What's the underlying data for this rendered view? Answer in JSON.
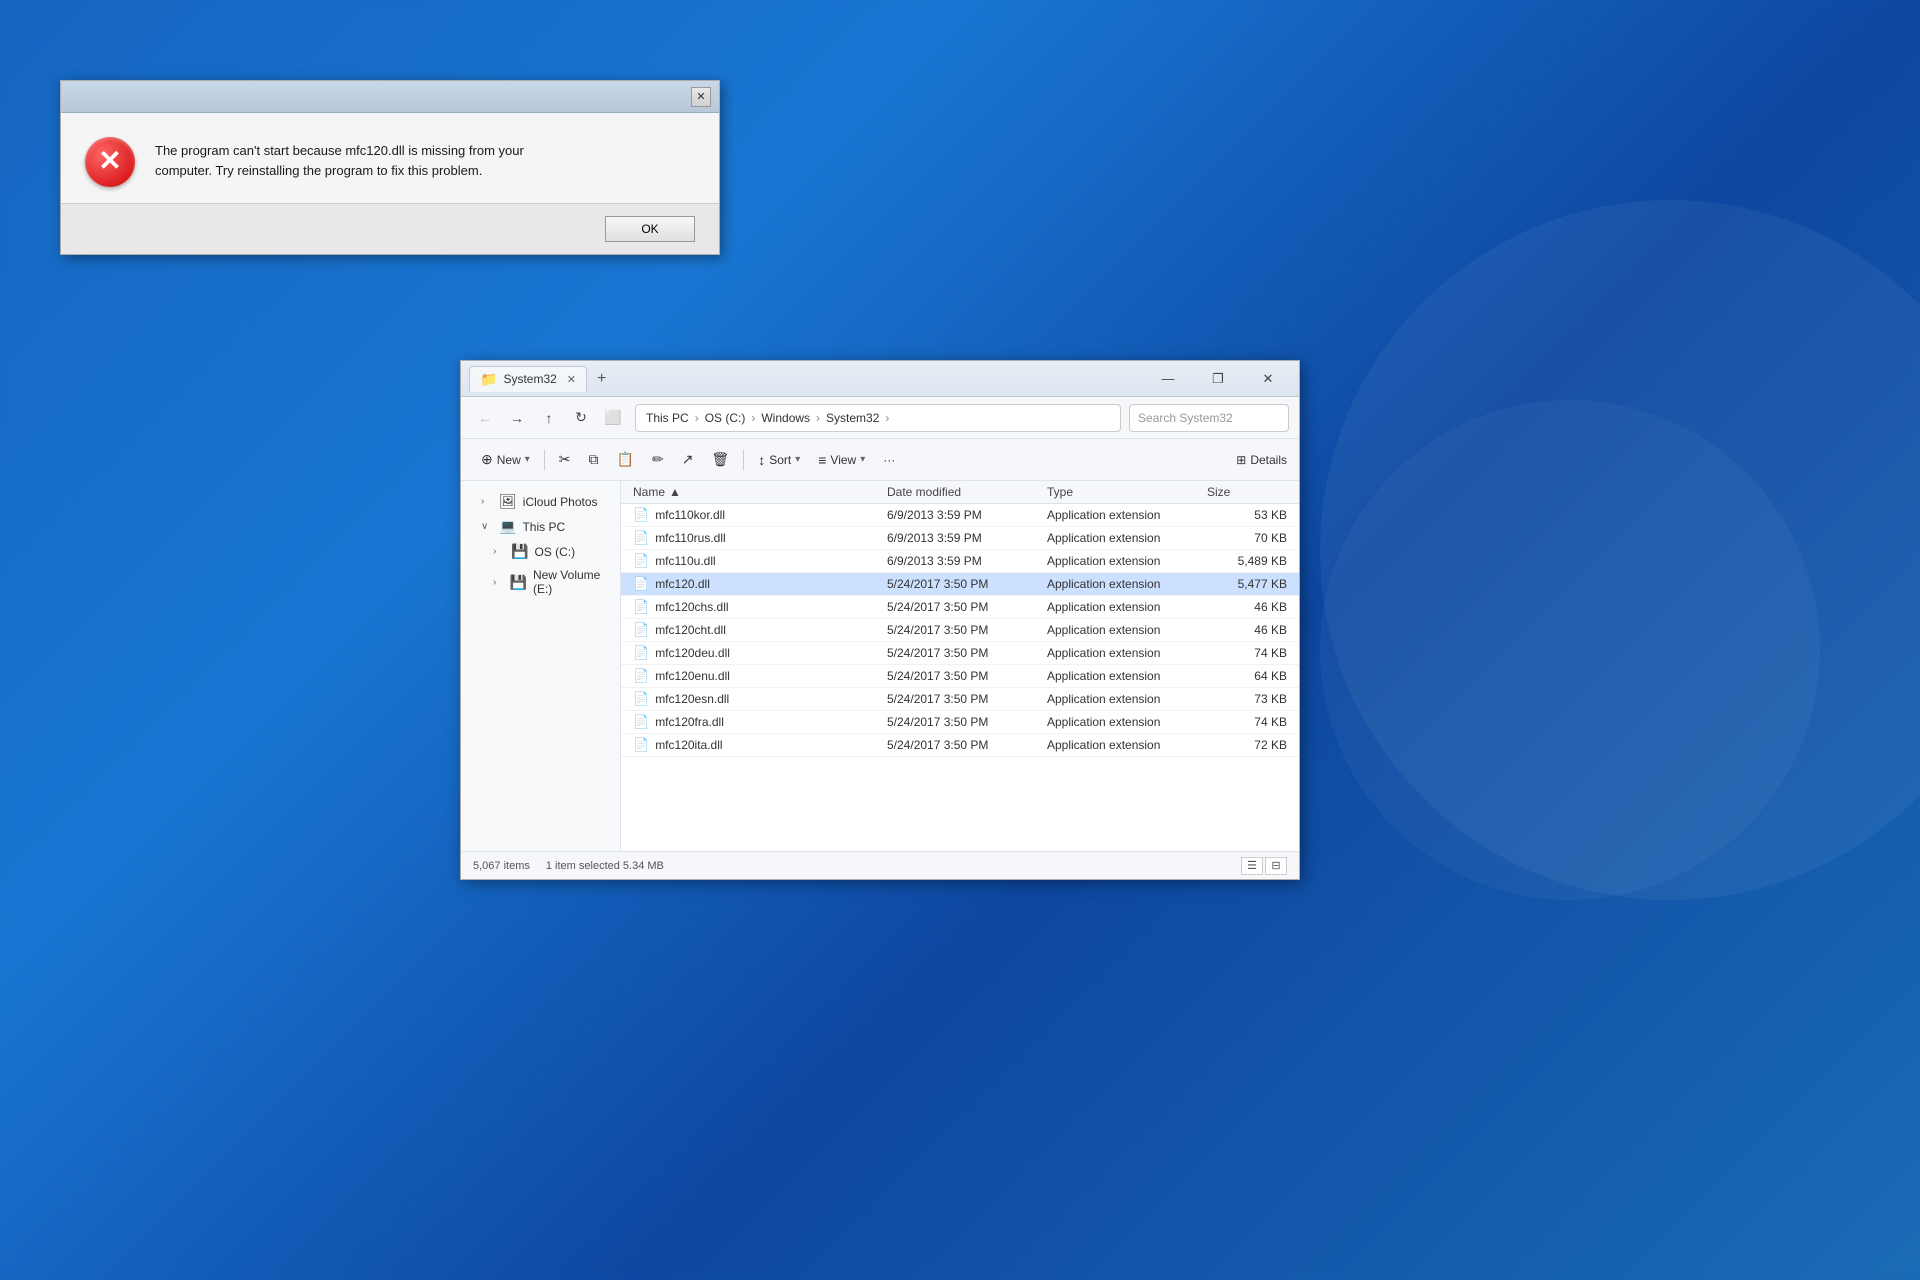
{
  "background": {
    "color": "#1565c0"
  },
  "error_dialog": {
    "title": "",
    "close_label": "✕",
    "icon_x": "✕",
    "message_line1": "The program can't start because mfc120.dll is missing from your",
    "message_line2": "computer. Try reinstalling the program to fix this problem.",
    "ok_label": "OK"
  },
  "explorer": {
    "tab_label": "System32",
    "tab_close": "✕",
    "tab_add": "+",
    "title_minimize": "—",
    "title_restore": "❐",
    "title_close": "✕",
    "nav_back": "←",
    "nav_forward": "→",
    "nav_up": "↑",
    "nav_refresh": "↻",
    "nav_folder": "⬜",
    "address_segments": [
      "This PC",
      "OS (C:)",
      "Windows",
      "System32"
    ],
    "search_placeholder": "Search System32",
    "cmd_new": "New",
    "cmd_cut": "✂",
    "cmd_copy": "⧉",
    "cmd_paste": "📋",
    "cmd_rename": "✏",
    "cmd_share": "↗",
    "cmd_delete": "🗑",
    "cmd_sort": "Sort",
    "cmd_view": "View",
    "cmd_more": "···",
    "cmd_details": "Details",
    "columns": {
      "name": "Name",
      "date_modified": "Date modified",
      "type": "Type",
      "size": "Size"
    },
    "files": [
      {
        "name": "mfc110kor.dll",
        "date": "6/9/2013 3:59 PM",
        "type": "Application extension",
        "size": "53 KB",
        "selected": false
      },
      {
        "name": "mfc110rus.dll",
        "date": "6/9/2013 3:59 PM",
        "type": "Application extension",
        "size": "70 KB",
        "selected": false
      },
      {
        "name": "mfc110u.dll",
        "date": "6/9/2013 3:59 PM",
        "type": "Application extension",
        "size": "5,489 KB",
        "selected": false
      },
      {
        "name": "mfc120.dll",
        "date": "5/24/2017 3:50 PM",
        "type": "Application extension",
        "size": "5,477 KB",
        "selected": true
      },
      {
        "name": "mfc120chs.dll",
        "date": "5/24/2017 3:50 PM",
        "type": "Application extension",
        "size": "46 KB",
        "selected": false
      },
      {
        "name": "mfc120cht.dll",
        "date": "5/24/2017 3:50 PM",
        "type": "Application extension",
        "size": "46 KB",
        "selected": false
      },
      {
        "name": "mfc120deu.dll",
        "date": "5/24/2017 3:50 PM",
        "type": "Application extension",
        "size": "74 KB",
        "selected": false
      },
      {
        "name": "mfc120enu.dll",
        "date": "5/24/2017 3:50 PM",
        "type": "Application extension",
        "size": "64 KB",
        "selected": false
      },
      {
        "name": "mfc120esn.dll",
        "date": "5/24/2017 3:50 PM",
        "type": "Application extension",
        "size": "73 KB",
        "selected": false
      },
      {
        "name": "mfc120fra.dll",
        "date": "5/24/2017 3:50 PM",
        "type": "Application extension",
        "size": "74 KB",
        "selected": false
      },
      {
        "name": "mfc120ita.dll",
        "date": "5/24/2017 3:50 PM",
        "type": "Application extension",
        "size": "72 KB",
        "selected": false
      }
    ],
    "sidebar": {
      "items": [
        {
          "label": "iCloud Photos",
          "icon": "🖼",
          "indent": 1,
          "expanded": false,
          "id": "icloud-photos"
        },
        {
          "label": "This PC",
          "icon": "💻",
          "indent": 1,
          "expanded": true,
          "id": "this-pc"
        },
        {
          "label": "OS (C:)",
          "icon": "💾",
          "indent": 2,
          "expanded": true,
          "id": "os-c"
        },
        {
          "label": "New Volume (E:)",
          "icon": "💾",
          "indent": 2,
          "expanded": false,
          "id": "new-volume-e"
        }
      ]
    },
    "statusbar": {
      "item_count": "5,067 items",
      "selection": "1 item selected  5.34 MB"
    }
  }
}
